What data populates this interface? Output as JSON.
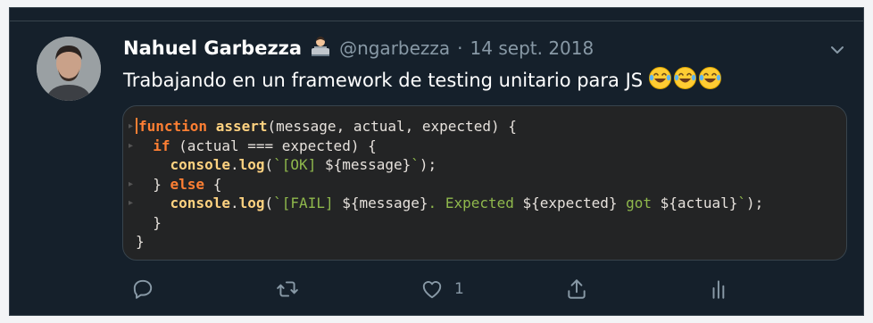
{
  "tweet": {
    "author_name": "Nahuel Garbezza",
    "author_badge_icon": "technologist-emoji-icon",
    "handle": "@ngarbezza",
    "separator": "·",
    "date": "14 sept. 2018",
    "text": "Trabajando en un framework de testing unitario para JS",
    "text_emojis": [
      "tears-of-joy-emoji-icon",
      "tears-of-joy-emoji-icon",
      "tears-of-joy-emoji-icon"
    ]
  },
  "code_image": {
    "lines": [
      {
        "parts": [
          {
            "t": "function",
            "c": "kw"
          },
          {
            "t": " "
          },
          {
            "t": "assert",
            "c": "fn"
          },
          {
            "t": "(message, actual, expected) {"
          }
        ]
      },
      {
        "parts": [
          {
            "t": "  "
          },
          {
            "t": "if",
            "c": "kw"
          },
          {
            "t": " (actual === expected) {"
          }
        ]
      },
      {
        "parts": [
          {
            "t": "    "
          },
          {
            "t": "console",
            "c": "fn"
          },
          {
            "t": "."
          },
          {
            "t": "log",
            "c": "fn"
          },
          {
            "t": "("
          },
          {
            "t": "`[OK] ",
            "c": "str"
          },
          {
            "t": "${message}",
            "c": "tpl"
          },
          {
            "t": "`",
            "c": "str"
          },
          {
            "t": ");"
          }
        ]
      },
      {
        "parts": [
          {
            "t": "  } "
          },
          {
            "t": "else",
            "c": "kw"
          },
          {
            "t": " {"
          }
        ]
      },
      {
        "parts": [
          {
            "t": "    "
          },
          {
            "t": "console",
            "c": "fn"
          },
          {
            "t": "."
          },
          {
            "t": "log",
            "c": "fn"
          },
          {
            "t": "("
          },
          {
            "t": "`[FAIL] ",
            "c": "str"
          },
          {
            "t": "${message}",
            "c": "tpl"
          },
          {
            "t": ". Expected ",
            "c": "str"
          },
          {
            "t": "${expected}",
            "c": "tpl"
          },
          {
            "t": " got ",
            "c": "str"
          },
          {
            "t": "${actual}",
            "c": "tpl"
          },
          {
            "t": "`",
            "c": "str"
          },
          {
            "t": ");"
          }
        ]
      },
      {
        "parts": [
          {
            "t": "  }"
          }
        ]
      },
      {
        "parts": [
          {
            "t": "}"
          }
        ]
      }
    ]
  },
  "actions": {
    "reply_icon": "reply-icon",
    "retweet_icon": "retweet-icon",
    "like_icon": "heart-icon",
    "like_count": "1",
    "share_icon": "share-icon",
    "analytics_icon": "analytics-icon"
  },
  "colors": {
    "background": "#15202b",
    "border": "#38444d",
    "text": "#ffffff",
    "muted": "#8899a6",
    "code_bg": "#232425"
  }
}
